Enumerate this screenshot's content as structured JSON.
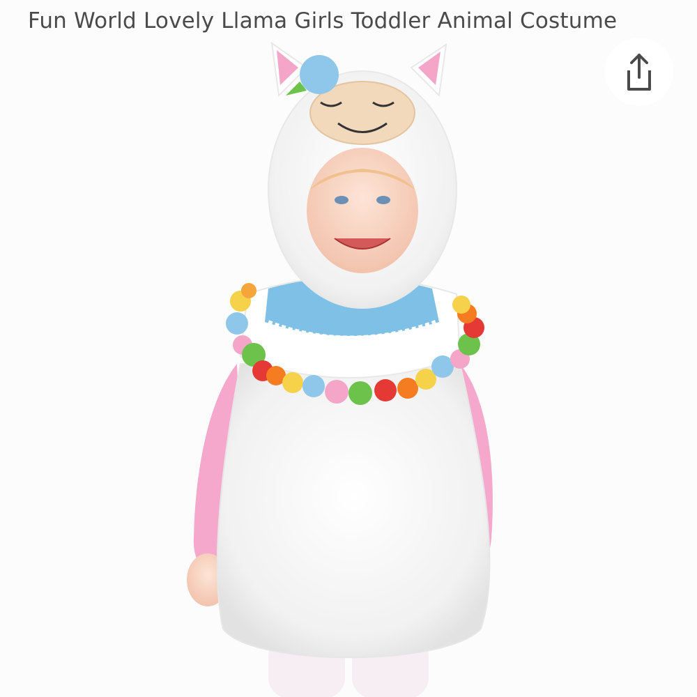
{
  "product": {
    "title": "Fun World Lovely Llama Girls Toddler Animal Costume",
    "image_alt": "Toddler wearing white plush llama costume with pom-pom collar"
  },
  "share": {
    "icon": "share-icon"
  },
  "colors": {
    "title_text": "#4a4a4a",
    "page_background": "#fcfcfc",
    "share_icon": "#4a4a4a"
  }
}
